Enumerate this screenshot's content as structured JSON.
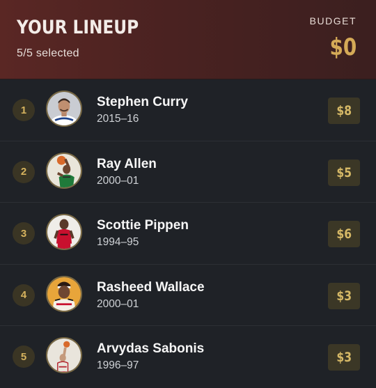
{
  "header": {
    "title": "YOUR LINEUP",
    "selected_text": "5/5  selected",
    "budget_label": "BUDGET",
    "budget_value": "$0"
  },
  "colors": {
    "header_bg": "#4a2221",
    "gold_accent": "#d5aa57",
    "row_bg": "#1f2227"
  },
  "lineup": [
    {
      "rank": "1",
      "name": "Stephen Curry",
      "season": "2015–16",
      "price": "$8",
      "jersey_color": "#ffffff",
      "trim_color": "#1d428a"
    },
    {
      "rank": "2",
      "name": "Ray Allen",
      "season": "2000–01",
      "price": "$5",
      "jersey_color": "#1f7a3a",
      "trim_color": "#2b2b2b"
    },
    {
      "rank": "3",
      "name": "Scottie Pippen",
      "season": "1994–95",
      "price": "$6",
      "jersey_color": "#c8102e",
      "trim_color": "#111111"
    },
    {
      "rank": "4",
      "name": "Rasheed Wallace",
      "season": "2000–01",
      "price": "$3",
      "jersey_color": "#f4f1e8",
      "trim_color": "#c8102e"
    },
    {
      "rank": "5",
      "name": "Arvydas Sabonis",
      "season": "1996–97",
      "price": "$3",
      "jersey_color": "#e9e5dc",
      "trim_color": "#b3202a"
    }
  ]
}
